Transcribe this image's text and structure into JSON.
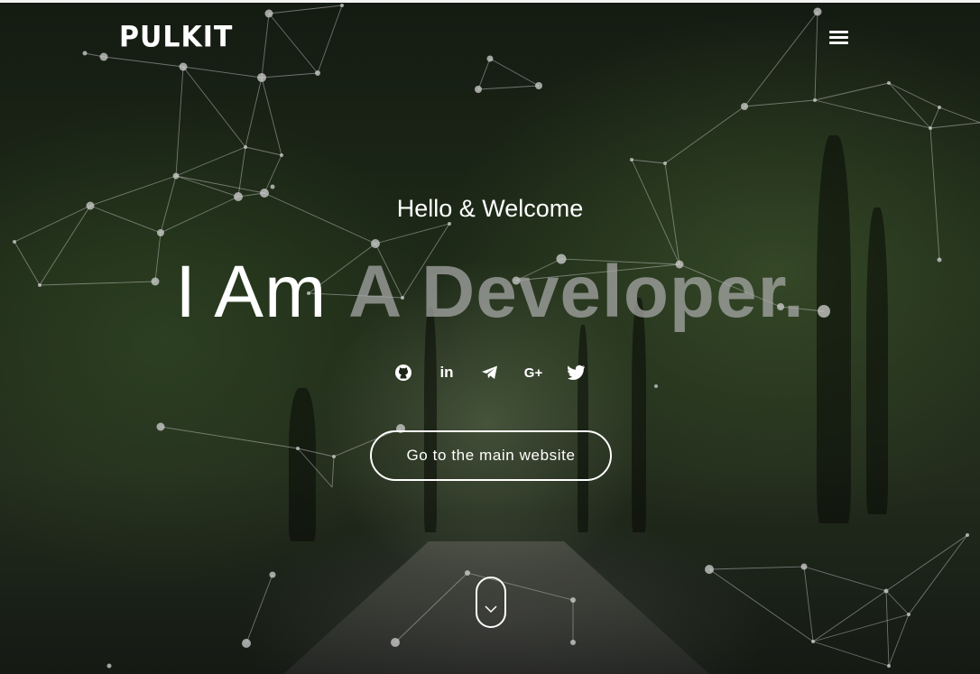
{
  "brand": {
    "logo_text": "PULKIT"
  },
  "nav": {
    "menu_icon": "hamburger-icon"
  },
  "hero": {
    "greeting": "Hello & Welcome",
    "headline_prefix": "I Am ",
    "headline_typed": "A Developer."
  },
  "socials": [
    {
      "name": "github",
      "icon": "github-icon",
      "glyph": ""
    },
    {
      "name": "linkedin",
      "icon": "linkedin-icon",
      "glyph": "in"
    },
    {
      "name": "telegram",
      "icon": "telegram-icon",
      "glyph": ""
    },
    {
      "name": "google-plus",
      "icon": "google-plus-icon",
      "glyph": "G+"
    },
    {
      "name": "twitter",
      "icon": "twitter-icon",
      "glyph": ""
    }
  ],
  "cta": {
    "label": "Go to the main website"
  },
  "scroll": {
    "icon": "chevron-down-icon"
  },
  "colors": {
    "text": "#ffffff",
    "typed_text": "#aaaaaa",
    "network_lines": "#dcdcdc",
    "top_border": "#f4f4f4"
  }
}
